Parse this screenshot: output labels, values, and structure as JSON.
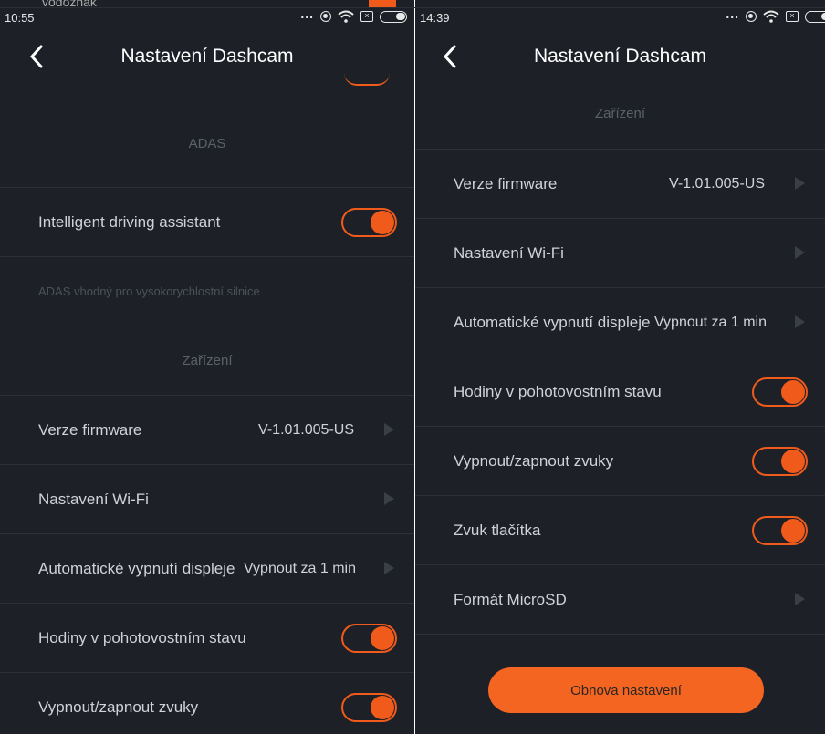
{
  "left": {
    "cropped_top_text": "vodoznak",
    "status": {
      "time": "10:55",
      "dots": "..."
    },
    "header": {
      "title": "Nastavení Dashcam"
    },
    "sections": {
      "adas": "ADAS",
      "adas_note": "ADAS vhodný pro vysokorychlostní silnice",
      "device": "Zařízení"
    },
    "rows": {
      "ida": {
        "label": "Intelligent driving assistant",
        "on": true
      },
      "firmware": {
        "label": "Verze firmware",
        "value": "V-1.01.005-US"
      },
      "wifi": {
        "label": "Nastavení Wi-Fi"
      },
      "auto_off": {
        "label": "Automatické vypnutí displeje",
        "value": "Vypnout za 1 min"
      },
      "standby_clock": {
        "label": "Hodiny v pohotovostním stavu",
        "on": true
      },
      "sounds": {
        "label": "Vypnout/zapnout zvuky",
        "on": true
      }
    }
  },
  "right": {
    "status": {
      "time": "14:39",
      "dots": "..."
    },
    "header": {
      "title": "Nastavení Dashcam"
    },
    "sections": {
      "device": "Zařízení"
    },
    "rows": {
      "firmware": {
        "label": "Verze firmware",
        "value": "V-1.01.005-US"
      },
      "wifi": {
        "label": "Nastavení Wi-Fi"
      },
      "auto_off": {
        "label": "Automatické vypnutí displeje",
        "value": "Vypnout za 1 min"
      },
      "standby_clock": {
        "label": "Hodiny v pohotovostním stavu",
        "on": true
      },
      "sounds": {
        "label": "Vypnout/zapnout zvuky",
        "on": true
      },
      "button_sound": {
        "label": "Zvuk tlačítka",
        "on": true
      },
      "format_sd": {
        "label": "Formát MicroSD"
      }
    },
    "reset_button": "Obnova nastavení"
  },
  "colors": {
    "accent": "#f05a1a",
    "background": "#1d2127",
    "text": "#cfd2d7",
    "section_text": "#5b606a"
  },
  "icons": [
    "back-chevron-icon",
    "dots-icon",
    "hotspot-icon",
    "wifi-icon",
    "sim-icon",
    "battery-icon",
    "chevron-right-icon"
  ]
}
